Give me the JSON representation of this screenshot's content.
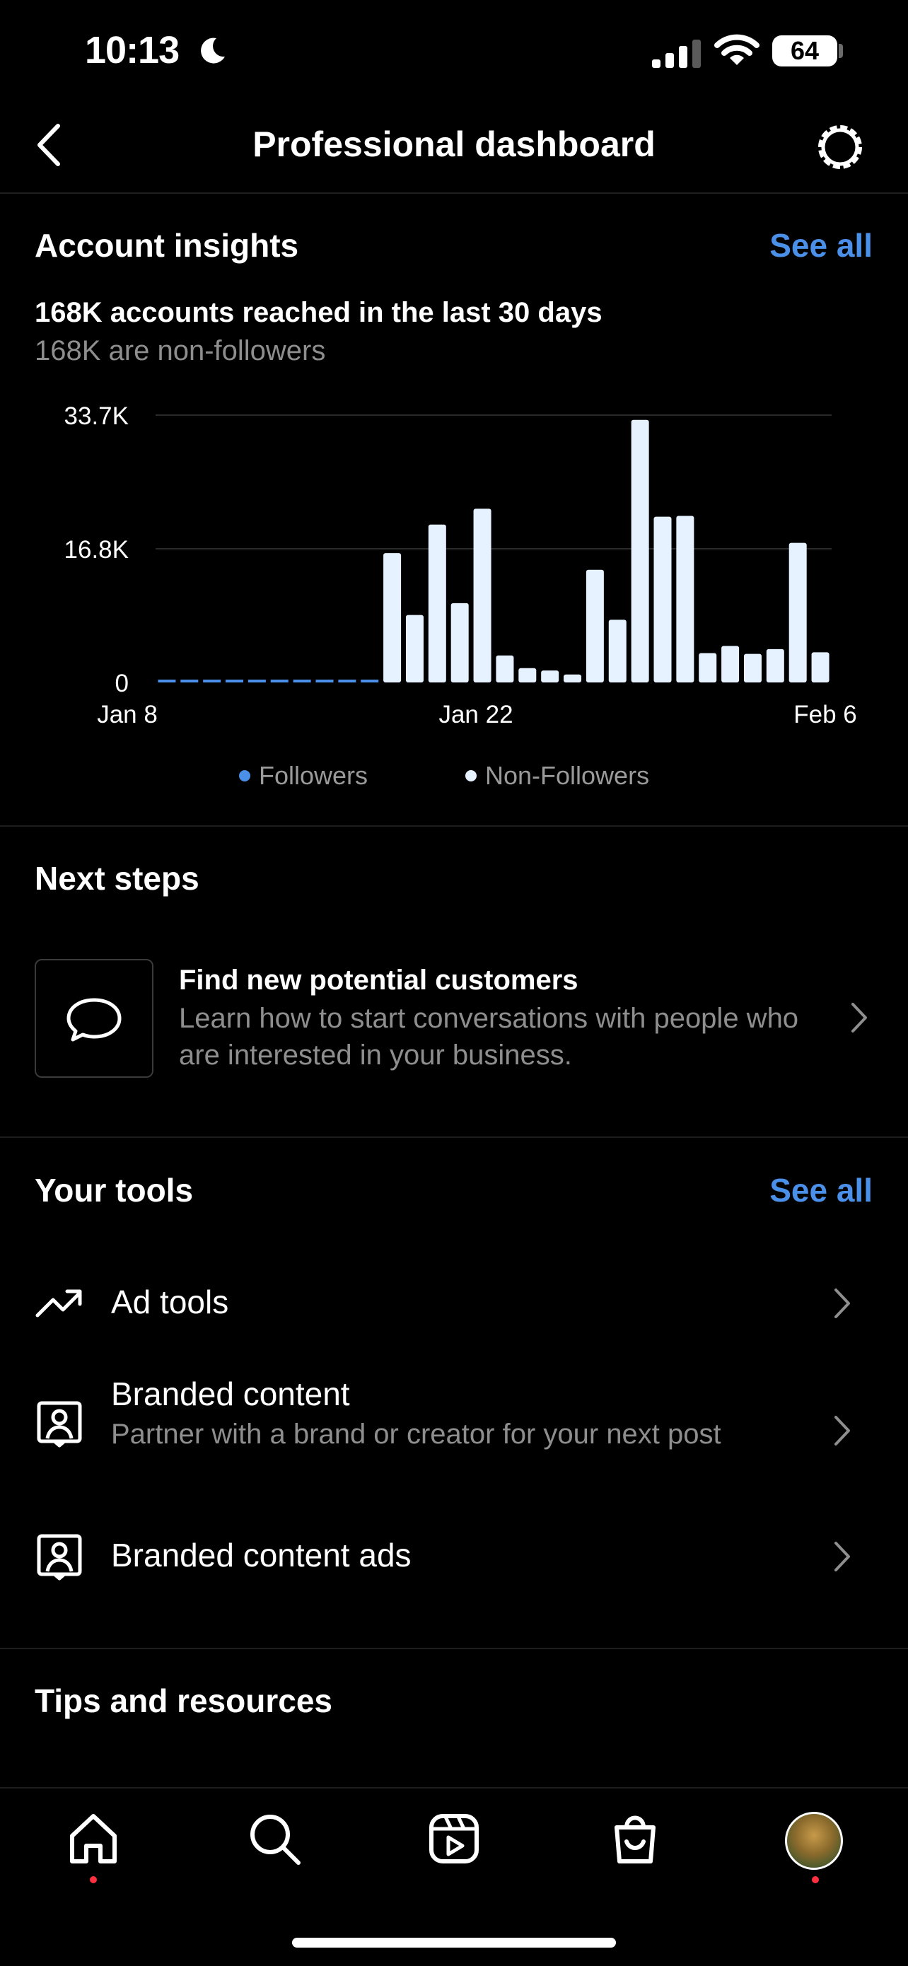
{
  "status_bar": {
    "time": "10:13",
    "battery": "64"
  },
  "header": {
    "title": "Professional dashboard"
  },
  "insights": {
    "title": "Account insights",
    "see_all": "See all",
    "reach": "168K accounts reached in the last 30 days",
    "reach_sub": "168K are non-followers"
  },
  "chart_data": {
    "type": "bar",
    "x_tick_labels": [
      "Jan 8",
      "Jan 22",
      "Feb 6"
    ],
    "y_tick_labels": [
      "33.7K",
      "16.8K",
      "0"
    ],
    "ylim": [
      0,
      33700
    ],
    "grid": true,
    "legend_position": "bottom-center",
    "series": [
      {
        "name": "Followers",
        "color": "#4a8fe8",
        "values": [
          120,
          120,
          120,
          120,
          120,
          120,
          120,
          120,
          120,
          120,
          120,
          120,
          120,
          120,
          120,
          120,
          120,
          120,
          120,
          120,
          120,
          120,
          120,
          120,
          120,
          120,
          120,
          120,
          120,
          120
        ]
      },
      {
        "name": "Non-Followers",
        "color": "#e6f2ff",
        "values": [
          0,
          0,
          0,
          0,
          0,
          0,
          0,
          0,
          0,
          0,
          16300,
          8500,
          19900,
          10000,
          21900,
          3400,
          1800,
          1500,
          1000,
          14200,
          7900,
          33100,
          20900,
          21000,
          3700,
          4600,
          3600,
          4200,
          17600,
          3800
        ]
      }
    ]
  },
  "next_steps": {
    "title": "Next steps",
    "card_title": "Find new potential customers",
    "card_desc": "Learn how to start conversations with people who are interested in your business."
  },
  "tools": {
    "title": "Your tools",
    "see_all": "See all",
    "items": [
      {
        "label": "Ad tools",
        "icon": "trending-up-icon"
      },
      {
        "label": "Branded content",
        "desc": "Partner with a brand or creator for your next post",
        "icon": "person-badge-icon"
      },
      {
        "label": "Branded content ads",
        "icon": "person-badge-icon"
      }
    ]
  },
  "tips": {
    "title": "Tips and resources"
  },
  "nav": {
    "items": [
      "home-icon",
      "search-icon",
      "reels-icon",
      "shop-icon",
      "profile-avatar"
    ]
  },
  "colors": {
    "accent": "#4a8fe8",
    "background": "#000000",
    "notification_dot": "#ff3040"
  }
}
